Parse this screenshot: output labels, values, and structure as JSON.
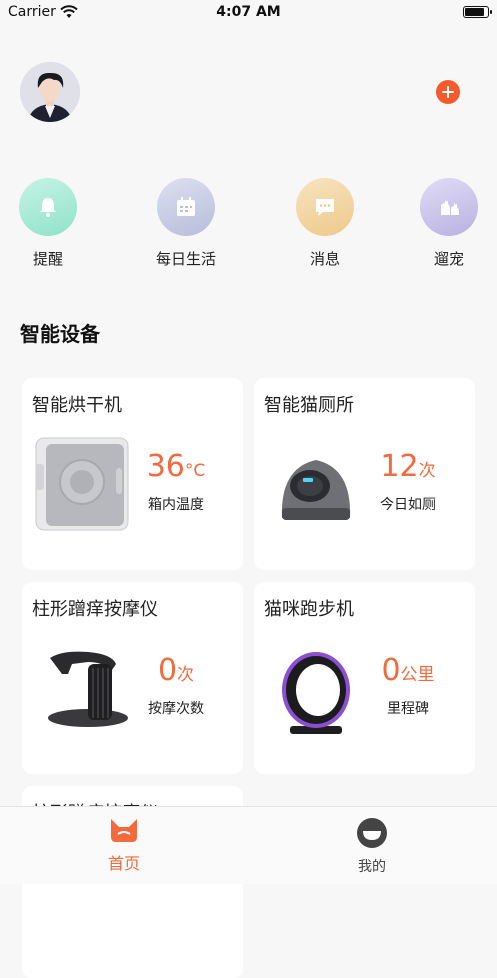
{
  "status_bar": {
    "carrier": "Carrier",
    "time": "4:07 AM"
  },
  "header": {
    "add_icon": "plus-circle-icon"
  },
  "quick_menu": [
    {
      "label": "提醒",
      "icon": "bell-icon",
      "color": "#a8ead6"
    },
    {
      "label": "每日生活",
      "icon": "calendar-icon",
      "color": "#c8cde6"
    },
    {
      "label": "消息",
      "icon": "chat-icon",
      "color": "#f2d7a5"
    },
    {
      "label": "遛宠",
      "icon": "pets-icon",
      "color": "#cdc7ea"
    }
  ],
  "section_title": "智能设备",
  "devices": [
    {
      "title": "智能烘干机",
      "value": "36",
      "unit": "°C",
      "label": "箱内温度"
    },
    {
      "title": "智能猫厕所",
      "value": "12",
      "unit": "次",
      "label": "今日如厕"
    },
    {
      "title": "柱形蹭痒按摩仪",
      "value": "0",
      "unit": "次",
      "label": "按摩次数"
    },
    {
      "title": "猫咪跑步机",
      "value": "0",
      "unit": "公里",
      "label": "里程碑"
    },
    {
      "title": "柱形蹭痒按摩仪"
    }
  ],
  "tabbar": {
    "home": {
      "label": "首页",
      "color": "#f26a3d"
    },
    "mine": {
      "label": "我的",
      "color": "#444444"
    }
  }
}
